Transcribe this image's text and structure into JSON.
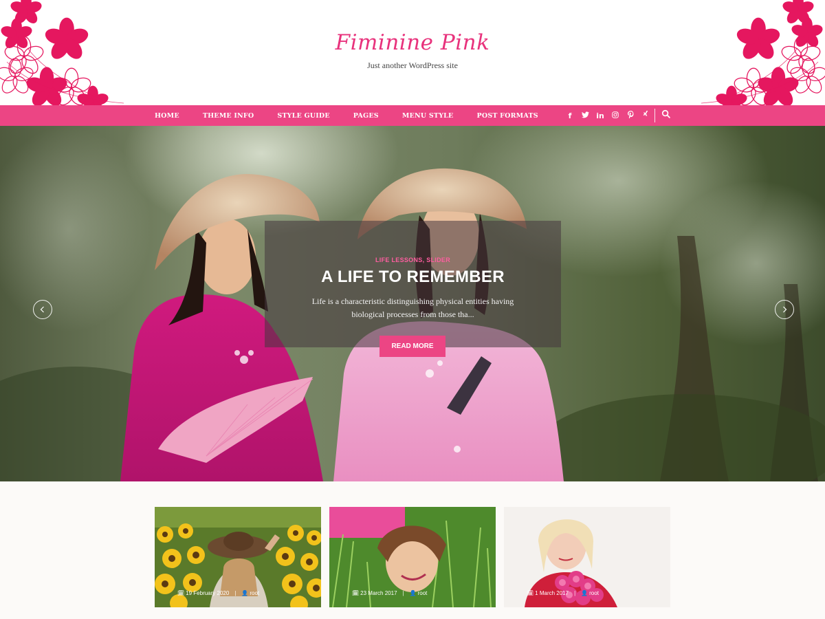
{
  "site": {
    "title": "Fiminine Pink",
    "description": "Just another WordPress site"
  },
  "colors": {
    "accent": "#ec4584",
    "title": "#e8327c",
    "flower": "#e5175f"
  },
  "nav": {
    "items": [
      {
        "label": "HOME"
      },
      {
        "label": "THEME INFO"
      },
      {
        "label": "STYLE GUIDE"
      },
      {
        "label": "PAGES"
      },
      {
        "label": "MENU STYLE"
      },
      {
        "label": "POST FORMATS"
      }
    ],
    "social": [
      {
        "icon": "facebook-icon",
        "glyph": "f"
      },
      {
        "icon": "twitter-icon",
        "glyph": "🐦"
      },
      {
        "icon": "linkedin-icon",
        "glyph": "in"
      },
      {
        "icon": "instagram-icon",
        "glyph": "◎"
      },
      {
        "icon": "pinterest-icon",
        "glyph": "P"
      },
      {
        "icon": "xing-icon",
        "glyph": "✕"
      }
    ],
    "search_icon": "search-icon"
  },
  "slider": {
    "categories": [
      "LIFE LESSONS",
      "SLIDER"
    ],
    "category_separator": ",",
    "title": "A LIFE TO REMEMBER",
    "excerpt": "Life is a characteristic distinguishing physical entities having biological processes from those tha...",
    "button_label": "READ MORE",
    "prev_icon": "chevron-left-icon",
    "next_icon": "chevron-right-icon"
  },
  "posts": [
    {
      "date": "19 February 2020",
      "author": "root"
    },
    {
      "date": "23 March 2017",
      "author": "root"
    },
    {
      "date": "1 March 2017",
      "author": "root"
    }
  ]
}
